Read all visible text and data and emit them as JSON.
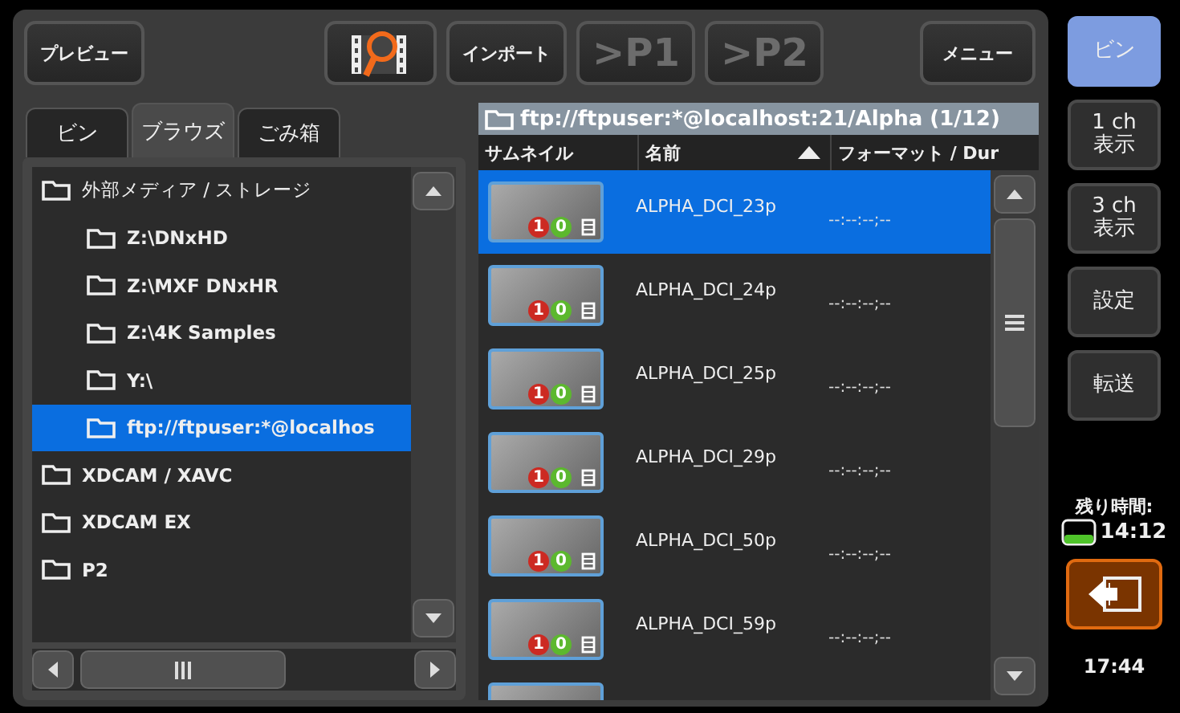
{
  "toolbar": [
    {
      "kind": "text",
      "label": "プレビュー",
      "disabled": false
    },
    {
      "kind": "icon",
      "disabled": false
    },
    {
      "kind": "text",
      "label": "インポート",
      "disabled": false
    },
    {
      "kind": "big",
      "label": ">P1",
      "disabled": true
    },
    {
      "kind": "big",
      "label": ">P2",
      "disabled": true
    },
    {
      "kind": "spacer"
    },
    {
      "kind": "text",
      "label": "メニュー",
      "disabled": false
    }
  ],
  "tabs": [
    {
      "label": "ビン",
      "selected": false
    },
    {
      "label": "ブラウズ",
      "selected": true
    },
    {
      "label": "ごみ箱",
      "selected": false
    }
  ],
  "tree": [
    {
      "label": "外部メディア / ストレージ",
      "selected": false,
      "children": [
        {
          "label": "Z:\\DNxHD",
          "selected": false
        },
        {
          "label": "Z:\\MXF DNxHR",
          "selected": false
        },
        {
          "label": "Z:\\4K Samples",
          "selected": false
        },
        {
          "label": "Y:\\",
          "selected": false
        },
        {
          "label": "ftp://ftpuser:*@localhos",
          "selected": true
        }
      ]
    },
    {
      "label": "XDCAM / XAVC",
      "selected": false
    },
    {
      "label": "XDCAM EX",
      "selected": false
    },
    {
      "label": "P2",
      "selected": false
    }
  ],
  "browser": {
    "path": "ftp://ftpuser:*@localhost:21/Alpha (1/12)",
    "columns": [
      {
        "label": "サムネイル",
        "sorted": false
      },
      {
        "label": "名前",
        "sorted": true
      },
      {
        "label": "フォーマット / Dur",
        "sorted": false
      }
    ],
    "rows": [
      {
        "name": "ALPHA_DCI_23p",
        "duration": "--:--:--;--",
        "selected": true,
        "badges": [
          {
            "text": "1",
            "color": "#cc2a22"
          },
          {
            "text": "0",
            "color": "#5cb82e"
          }
        ]
      },
      {
        "name": "ALPHA_DCI_24p",
        "duration": "--:--:--;--",
        "selected": false,
        "badges": [
          {
            "text": "1",
            "color": "#cc2a22"
          },
          {
            "text": "0",
            "color": "#5cb82e"
          }
        ]
      },
      {
        "name": "ALPHA_DCI_25p",
        "duration": "--:--:--;--",
        "selected": false,
        "badges": [
          {
            "text": "1",
            "color": "#cc2a22"
          },
          {
            "text": "0",
            "color": "#5cb82e"
          }
        ]
      },
      {
        "name": "ALPHA_DCI_29p",
        "duration": "--:--:--;--",
        "selected": false,
        "badges": [
          {
            "text": "1",
            "color": "#cc2a22"
          },
          {
            "text": "0",
            "color": "#5cb82e"
          }
        ]
      },
      {
        "name": "ALPHA_DCI_50p",
        "duration": "--:--:--;--",
        "selected": false,
        "badges": [
          {
            "text": "1",
            "color": "#cc2a22"
          },
          {
            "text": "0",
            "color": "#5cb82e"
          }
        ]
      },
      {
        "name": "ALPHA_DCI_59p",
        "duration": "--:--:--;--",
        "selected": false,
        "badges": [
          {
            "text": "1",
            "color": "#cc2a22"
          },
          {
            "text": "0",
            "color": "#5cb82e"
          }
        ]
      },
      {
        "selected": false
      }
    ]
  },
  "side": {
    "buttons": [
      {
        "label": "ビン",
        "selected": true
      },
      {
        "label": "1 ch\n表示",
        "selected": false
      },
      {
        "label": "3 ch\n表示",
        "selected": false
      },
      {
        "label": "設定",
        "selected": false
      },
      {
        "label": "転送",
        "selected": false
      }
    ],
    "remaining_label": "残り時間:",
    "remaining": "14:12",
    "clock": "17:44"
  }
}
